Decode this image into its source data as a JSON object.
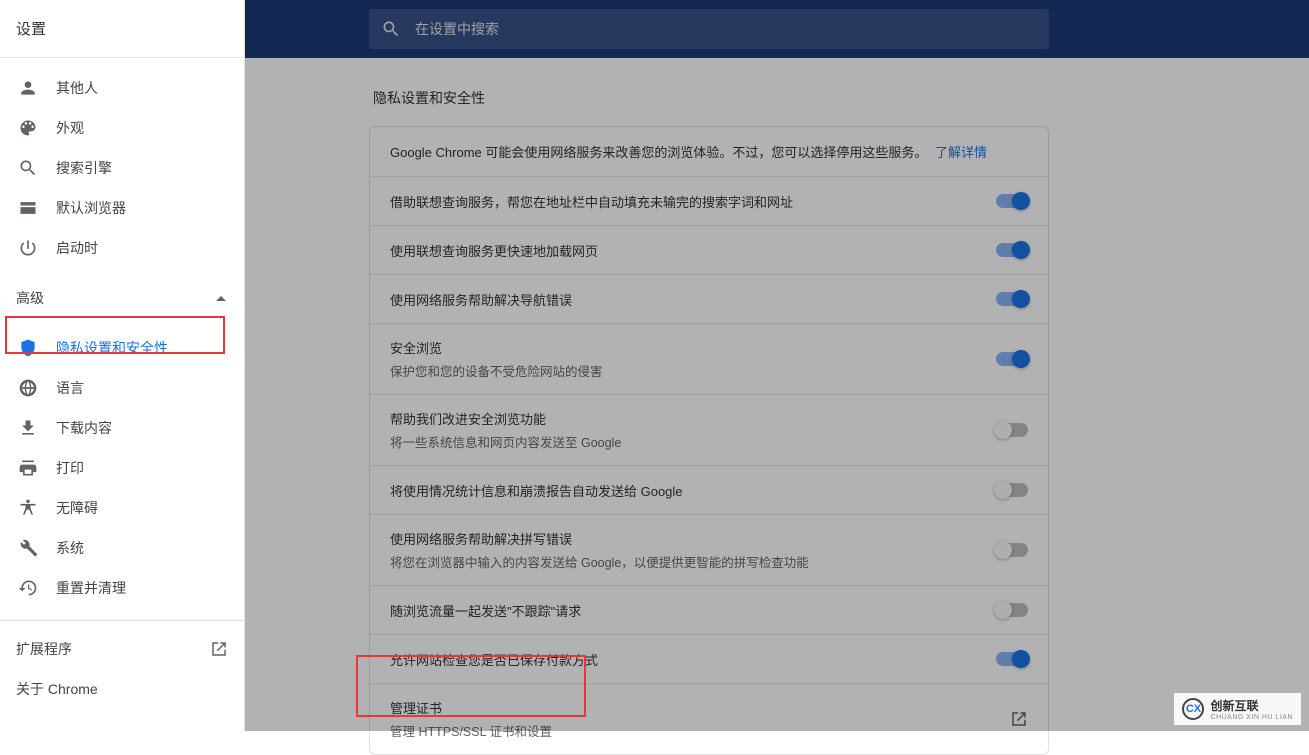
{
  "sidebar": {
    "title": "设置",
    "items_basic": [
      {
        "label": "其他人",
        "icon": "person-icon"
      },
      {
        "label": "外观",
        "icon": "palette-icon"
      },
      {
        "label": "搜索引擎",
        "icon": "search-icon"
      },
      {
        "label": "默认浏览器",
        "icon": "browser-icon"
      },
      {
        "label": "启动时",
        "icon": "power-icon"
      }
    ],
    "advanced_label": "高级",
    "items_advanced": [
      {
        "label": "隐私设置和安全性",
        "icon": "shield-icon",
        "active": true
      },
      {
        "label": "语言",
        "icon": "globe-icon"
      },
      {
        "label": "下载内容",
        "icon": "download-icon"
      },
      {
        "label": "打印",
        "icon": "print-icon"
      },
      {
        "label": "无障碍",
        "icon": "accessibility-icon"
      },
      {
        "label": "系统",
        "icon": "wrench-icon"
      },
      {
        "label": "重置并清理",
        "icon": "restore-icon"
      }
    ],
    "extensions_label": "扩展程序",
    "about_label": "关于 Chrome"
  },
  "search": {
    "placeholder": "在设置中搜索"
  },
  "section": {
    "title": "隐私设置和安全性",
    "intro_text": "Google Chrome 可能会使用网络服务来改善您的浏览体验。不过，您可以选择停用这些服务。",
    "intro_link": "了解详情",
    "rows": [
      {
        "title": "借助联想查询服务，帮您在地址栏中自动填充未输完的搜索字词和网址",
        "sub": "",
        "toggle": "on"
      },
      {
        "title": "使用联想查询服务更快速地加载网页",
        "sub": "",
        "toggle": "on"
      },
      {
        "title": "使用网络服务帮助解决导航错误",
        "sub": "",
        "toggle": "on"
      },
      {
        "title": "安全浏览",
        "sub": "保护您和您的设备不受危险网站的侵害",
        "toggle": "on"
      },
      {
        "title": "帮助我们改进安全浏览功能",
        "sub": "将一些系统信息和网页内容发送至 Google",
        "toggle": "off"
      },
      {
        "title": "将使用情况统计信息和崩溃报告自动发送给 Google",
        "sub": "",
        "toggle": "off"
      },
      {
        "title": "使用网络服务帮助解决拼写错误",
        "sub": "将您在浏览器中输入的内容发送给 Google，以便提供更智能的拼写检查功能",
        "toggle": "off"
      },
      {
        "title": "随浏览流量一起发送\"不跟踪\"请求",
        "sub": "",
        "toggle": "off"
      },
      {
        "title": "允许网站检查您是否已保存付款方式",
        "sub": "",
        "toggle": "on"
      },
      {
        "title": "管理证书",
        "sub": "管理 HTTPS/SSL 证书和设置",
        "toggle": "link"
      }
    ]
  },
  "watermark": {
    "brand": "创新互联",
    "sub": "CHUANG XIN HU LIAN",
    "logo": "CX"
  }
}
